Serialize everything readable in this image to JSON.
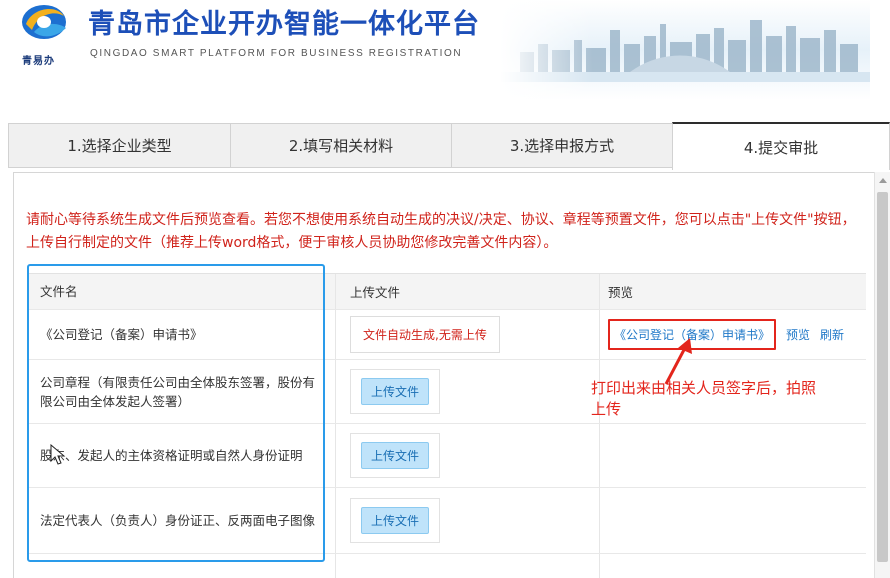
{
  "header": {
    "title": "青岛市企业开办智能一体化平台",
    "subtitle": "QINGDAO SMART PLATFORM FOR BUSINESS REGISTRATION",
    "logo_caption": "青易办",
    "brand_color": "#1d4fb8"
  },
  "tabs": [
    {
      "label": "1.选择企业类型",
      "active": false
    },
    {
      "label": "2.填写相关材料",
      "active": false
    },
    {
      "label": "3.选择申报方式",
      "active": false
    },
    {
      "label": "4.提交审批",
      "active": true
    }
  ],
  "notice": "请耐心等待系统生成文件后预览查看。若您不想使用系统自动生成的决议/决定、协议、章程等预置文件，您可以点击\"上传文件\"按钮，上传自行制定的文件（推荐上传word格式，便于审核人员协助您修改完善文件内容）。",
  "table": {
    "headers": [
      "文件名",
      "上传文件",
      "预览"
    ],
    "rows": [
      {
        "name": "《公司登记（备案）申请书》",
        "upload": "文件自动生成,无需上传",
        "preview": {
          "link": "《公司登记（备案）申请书》",
          "view": "预览",
          "refresh": "刷新"
        }
      },
      {
        "name": "公司章程（有限责任公司由全体股东签署，股份有限公司由全体发起人签署）",
        "upload": "上传文件"
      },
      {
        "name": "股东、发起人的主体资格证明或自然人身份证明",
        "upload": "上传文件"
      },
      {
        "name": "法定代表人（负责人）身份证正、反两面电子图像",
        "upload": "上传文件"
      }
    ]
  },
  "annotation": "打印出来由相关人员签字后，拍照上传",
  "colors": {
    "notice": "#d0231b",
    "highlight_blue": "#2a9bea",
    "annotation_red": "#e3251c",
    "link": "#1f78c8"
  }
}
